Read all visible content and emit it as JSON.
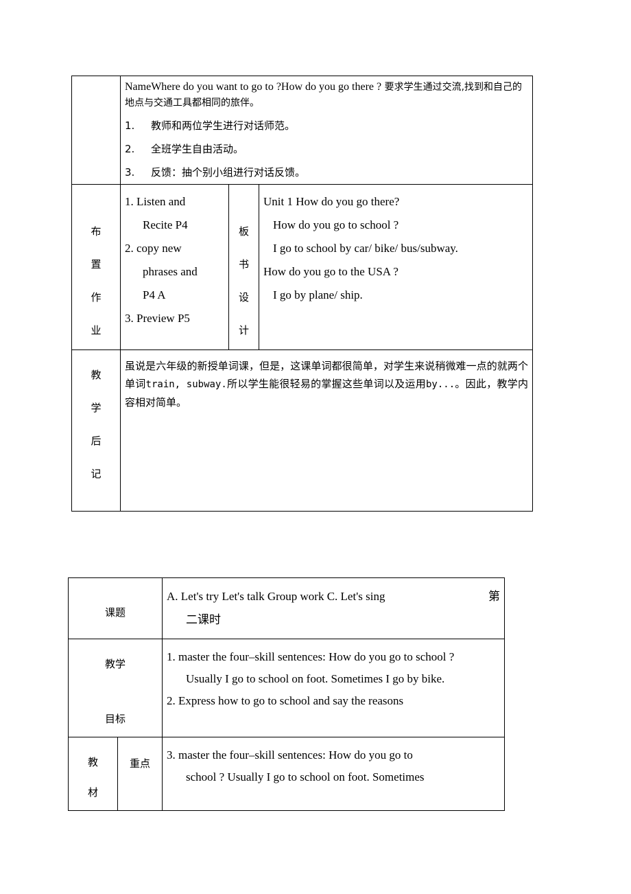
{
  "document": {
    "table1": {
      "intro_row": {
        "english_line": "NameWhere do you want to go to ?How do you go there ?",
        "chinese_tail": "要求学生通过交流,找到和自己的地点与交通工具都相同的旅伴。",
        "activities": [
          {
            "num": "1.",
            "text": "教师和两位学生进行对话师范。"
          },
          {
            "num": "2.",
            "text": "全班学生自由活动。"
          },
          {
            "num": "3.",
            "text": "反馈：抽个别小组进行对话反馈。"
          }
        ]
      },
      "homework_row": {
        "label": "布置作业",
        "lines": [
          "1.  Listen     and",
          "Recite P4",
          "2.  copy     new",
          "phrases    and",
          "P4 A",
          "3.  Preview P5"
        ],
        "board_label": "板书设计",
        "board_lines": [
          "Unit 1     How do you go there?",
          "How do you go to school ?",
          "I go to school by car/ bike/ bus/subway.",
          "How do you go to the USA ?",
          "I go by plane/ ship."
        ]
      },
      "afternote_row": {
        "label": "教学后记",
        "text_part1": "虽说是六年级的新授单词课，但是，这课单词都很简单，对学生来说稍微难一点的就两个单词",
        "text_mono": "train, subway.",
        "text_part2": "所以学生能很轻易的掌握这些单词以及运用",
        "text_mono2": "by...",
        "text_part3": "。因此，教学内容相对简单。"
      }
    },
    "table2": {
      "topic_row": {
        "label": "课题",
        "content_line1": "A. Let's try   Let's talk    Group work    C. Let's sing",
        "content_right": "第",
        "content_line2": "二课时"
      },
      "goal_row": {
        "label": "教学目标",
        "lines": [
          "1.  master the four–skill sentences: How do you go to school ?",
          "Usually I go to school on foot. Sometimes I go by bike.",
          "2.  Express how to go to school and say the reasons"
        ]
      },
      "material_row": {
        "label": "教材",
        "sublabel": "重点",
        "lines": [
          "3.  master the four–skill sentences: How do you go to",
          "school ? Usually I go to school on foot. Sometimes"
        ]
      }
    }
  }
}
